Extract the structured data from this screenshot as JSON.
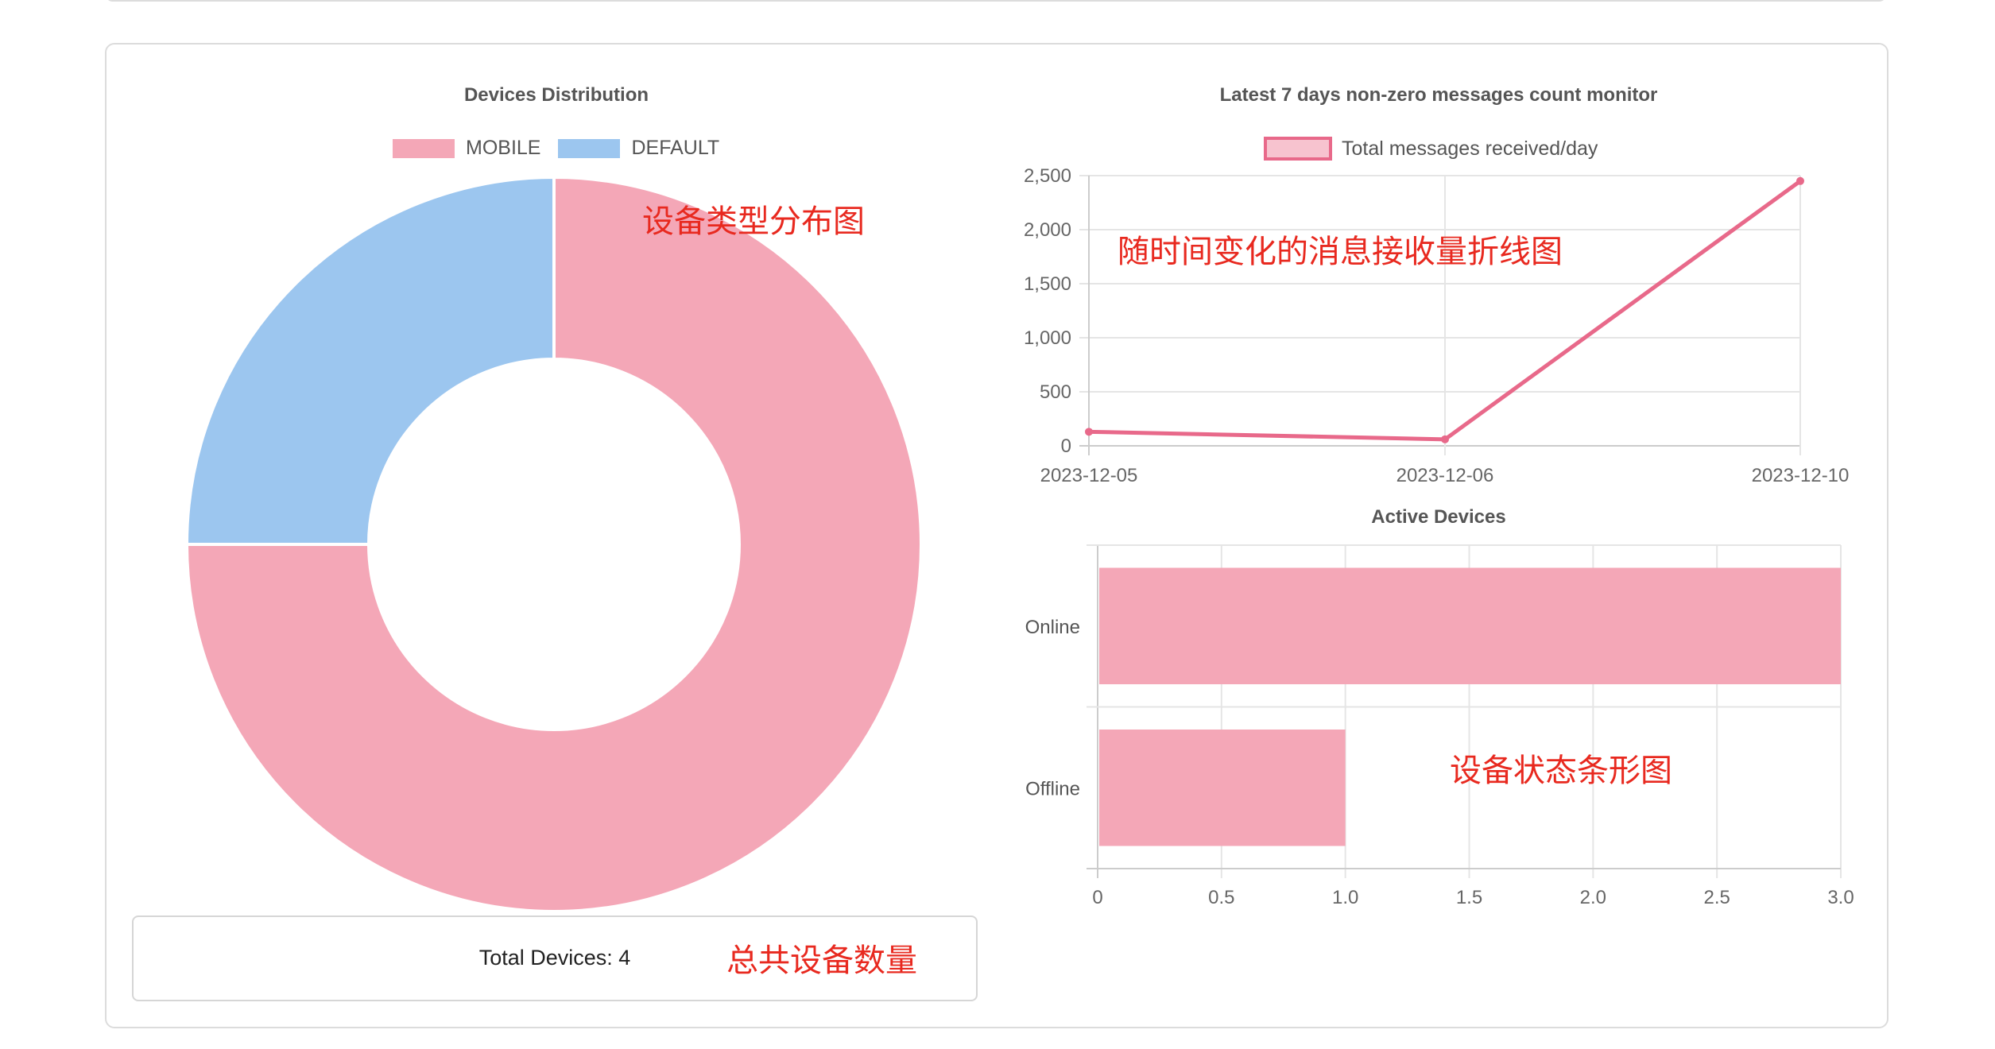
{
  "annotations": {
    "donut": "设备类型分布图",
    "line": "随时间变化的消息接收量折线图",
    "bar": "设备状态条形图",
    "total": "总共设备数量"
  },
  "summary": {
    "total_label": "Total Devices:",
    "total_value": "4"
  },
  "colors": {
    "pink": "#f4a7b7",
    "pink_border": "#e8698a",
    "blue": "#9cc6ef",
    "grid": "#e5e5e5",
    "axis_text": "#666666"
  },
  "chart_data": [
    {
      "type": "pie",
      "title": "Devices Distribution",
      "labels": [
        "MOBILE",
        "DEFAULT"
      ],
      "values": [
        3,
        1
      ],
      "colors": [
        "#f4a7b7",
        "#9cc6ef"
      ],
      "donut": true,
      "legend": "top"
    },
    {
      "type": "line",
      "title": "Latest 7 days non-zero messages count monitor",
      "x": [
        "2023-12-05",
        "2023-12-06",
        "2023-12-10"
      ],
      "series": [
        {
          "name": "Total messages received/day",
          "values": [
            130,
            60,
            2450
          ]
        }
      ],
      "yticks": [
        "0",
        "500",
        "1,000",
        "1,500",
        "2,000",
        "2,500"
      ],
      "ylim": [
        0,
        2500
      ],
      "grid": true,
      "legend": "top"
    },
    {
      "type": "bar",
      "orientation": "horizontal",
      "title": "Active Devices",
      "categories": [
        "Online",
        "Offline"
      ],
      "values": [
        3,
        1
      ],
      "xticks": [
        "0",
        "0.5",
        "1.0",
        "1.5",
        "2.0",
        "2.5",
        "3.0"
      ],
      "xlim": [
        0,
        3
      ],
      "grid": true
    }
  ]
}
